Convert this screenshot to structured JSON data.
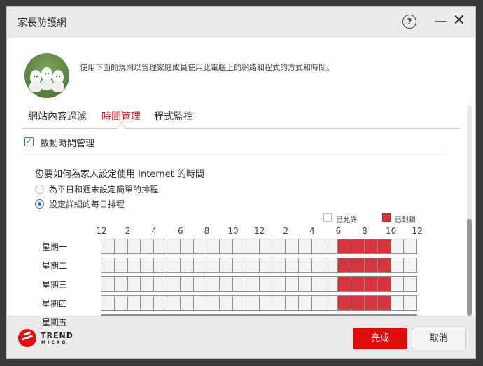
{
  "window": {
    "title": "家長防護網"
  },
  "header": {
    "description": "使用下面的規則以管理家庭成員使用此電腦上的網路和程式的方式和時間。"
  },
  "tabs": [
    {
      "label": "網站內容過濾",
      "active": false
    },
    {
      "label": "時間管理",
      "active": true
    },
    {
      "label": "程式監控",
      "active": false
    }
  ],
  "enable": {
    "label": "啟動時間管理",
    "checked": true
  },
  "question": "您要如何為家人設定使用 Internet 的時間",
  "options": [
    {
      "label": "為平日和週末設定簡單的排程",
      "selected": false
    },
    {
      "label": "設定詳細的每日排程",
      "selected": true
    }
  ],
  "legend": {
    "allowed": "已允許",
    "blocked": "已封鎖"
  },
  "hours": [
    "12",
    "2",
    "4",
    "6",
    "8",
    "10",
    "12",
    "2",
    "4",
    "6",
    "8",
    "10",
    "12"
  ],
  "days": [
    "星期一",
    "星期二",
    "星期三",
    "星期四",
    "星期五"
  ],
  "blocked_hours": [
    18,
    19,
    20,
    21
  ],
  "footer": {
    "brand_line1": "TREND",
    "brand_line2": "MICRO",
    "done": "完成",
    "cancel": "取消"
  },
  "colors": {
    "accent": "#e00c0c",
    "blocked": "#d8343d",
    "link": "#2a6fce"
  }
}
